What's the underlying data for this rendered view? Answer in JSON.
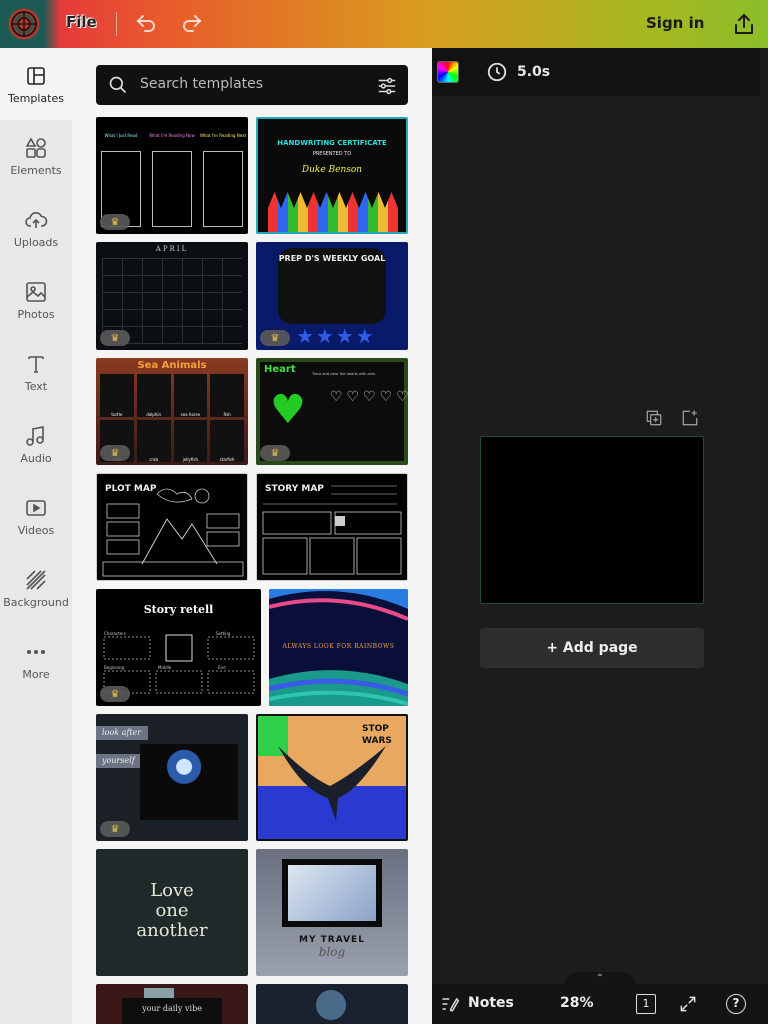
{
  "topbar": {
    "file_label": "File",
    "signin_label": "Sign in",
    "logo_icon": "app-logo-icon",
    "undo_icon": "undo-icon",
    "redo_icon": "redo-icon",
    "share_icon": "share-icon"
  },
  "rail": {
    "items": [
      {
        "label": "Templates",
        "icon": "templates-icon"
      },
      {
        "label": "Elements",
        "icon": "elements-icon"
      },
      {
        "label": "Uploads",
        "icon": "upload-cloud-icon"
      },
      {
        "label": "Photos",
        "icon": "photo-icon"
      },
      {
        "label": "Text",
        "icon": "text-icon"
      },
      {
        "label": "Audio",
        "icon": "music-note-icon"
      },
      {
        "label": "Videos",
        "icon": "video-icon"
      },
      {
        "label": "Background",
        "icon": "background-stripes-icon"
      },
      {
        "label": "More",
        "icon": "more-dots-icon"
      }
    ]
  },
  "search": {
    "placeholder": "Search templates",
    "search_icon": "search-icon",
    "filter_icon": "filter-sliders-icon"
  },
  "templates": {
    "t1": {
      "h1": "What I Just Read",
      "h2": "What I'm Reading Now",
      "h3": "What I'm Reading Next"
    },
    "t2": {
      "title": "HANDWRITING CERTIFICATE",
      "sub": "PRESENTED TO",
      "name": "Duke Benson"
    },
    "t3": {
      "title": "APRIL"
    },
    "t4": {
      "title": "PREP D'S WEEKLY GOAL"
    },
    "t5": {
      "title": "Sea Animals",
      "labels": [
        "turtle",
        "dolphin",
        "sea horse",
        "fish",
        "crab",
        "crab",
        "jellyfish",
        "starfish"
      ]
    },
    "t6": {
      "title": "Heart",
      "sub": "Trace and color the hearts with pink."
    },
    "t7": {
      "title": "PLOT MAP"
    },
    "t8": {
      "title": "STORY MAP"
    },
    "t9": {
      "title": "Story retell",
      "labels": [
        "Characters",
        "Setting",
        "Beginning",
        "Middle",
        "End"
      ]
    },
    "t10": {
      "title": "ALWAYS LOOK FOR RAINBOWS"
    },
    "t11": {
      "line1": "look after",
      "line2": "yourself"
    },
    "t12": {
      "line1": "STOP",
      "line2": "WARS"
    },
    "t13": {
      "line1": "Love",
      "line2": "one",
      "line3": "another"
    },
    "t14": {
      "title": "MY TRAVEL",
      "sub": "blog"
    },
    "t15": {
      "title": "your daily vibe"
    }
  },
  "editor": {
    "duration": "5.0s",
    "add_page_label": "+ Add page",
    "notes_label": "Notes",
    "zoom": "28%",
    "page_number": "1",
    "help_label": "?",
    "collapse_glyph": "‹",
    "notch_glyph": "⌃",
    "canvas_border_color": "#1e4b46"
  },
  "colors": {
    "topbar_gradient": [
      "#1e5b55",
      "#e63a3a",
      "#e85a2c",
      "#d99c1e",
      "#8cbd2a"
    ],
    "premium_crown": "#e6c14a"
  }
}
